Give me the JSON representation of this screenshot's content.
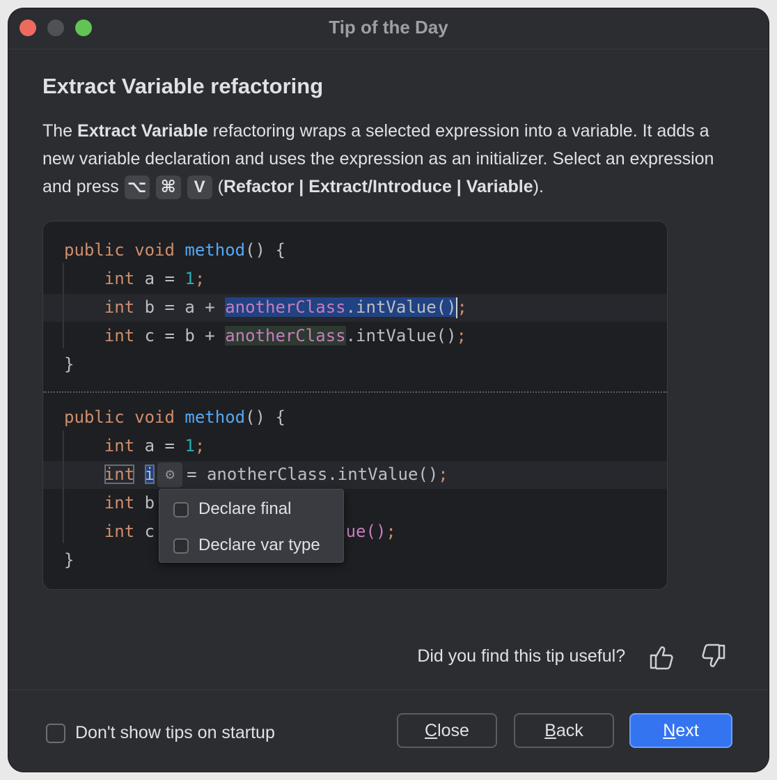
{
  "window": {
    "title": "Tip of the Day"
  },
  "tip": {
    "heading": "Extract Variable refactoring",
    "desc_1": "The ",
    "desc_bold": "Extract Variable",
    "desc_2": " refactoring wraps a selected expression into a variable. It adds a new variable declaration and uses the expression as an initializer. Select an expression and press ",
    "keys": [
      "⌥",
      "⌘",
      "V"
    ],
    "desc_3": " (",
    "menu_path": "Refactor | Extract/Introduce | Variable",
    "desc_4": ")."
  },
  "code_before": {
    "l1": {
      "kw": "public void",
      "fn": "method",
      "rest": "() {"
    },
    "l2": {
      "type": "int",
      "mid": " a = ",
      "num": "1",
      "end": ";"
    },
    "l3": {
      "type": "int",
      "mid": " b = a + ",
      "field": "anotherClass",
      "call": ".intValue()",
      "end": ";"
    },
    "l4": {
      "type": "int",
      "mid": " c = b + ",
      "field": "anotherClass",
      "call": ".intValue()",
      "end": ";"
    },
    "l5": "}"
  },
  "code_after": {
    "l1": {
      "kw": "public void",
      "fn": "method",
      "rest": "() {"
    },
    "l2": {
      "type": "int",
      "mid": " a = ",
      "num": "1",
      "end": ";"
    },
    "l3": {
      "type": "int",
      "var": "i",
      "rest": "= anotherClass.intValue()",
      "end": ";"
    },
    "l4": {
      "type": "int",
      "mid": " b"
    },
    "l5": {
      "type": "int",
      "mid": " c",
      "tail": "s.intValue()",
      "end": ";"
    },
    "l6": "}"
  },
  "popup": {
    "options": [
      "Declare final",
      "Declare var type"
    ]
  },
  "feedback": {
    "question": "Did you find this tip useful?"
  },
  "footer": {
    "dont_show": "Don't show tips on startup",
    "close_mn": "C",
    "close_rest": "lose",
    "back_mn": "B",
    "back_rest": "ack",
    "next_mn": "N",
    "next_rest": "ext"
  },
  "colors": {
    "accent": "#3574f0",
    "background": "#2b2d30",
    "editor": "#1e1f22"
  },
  "icons": [
    "gear-icon",
    "thumbs-up-icon",
    "thumbs-down-icon"
  ]
}
